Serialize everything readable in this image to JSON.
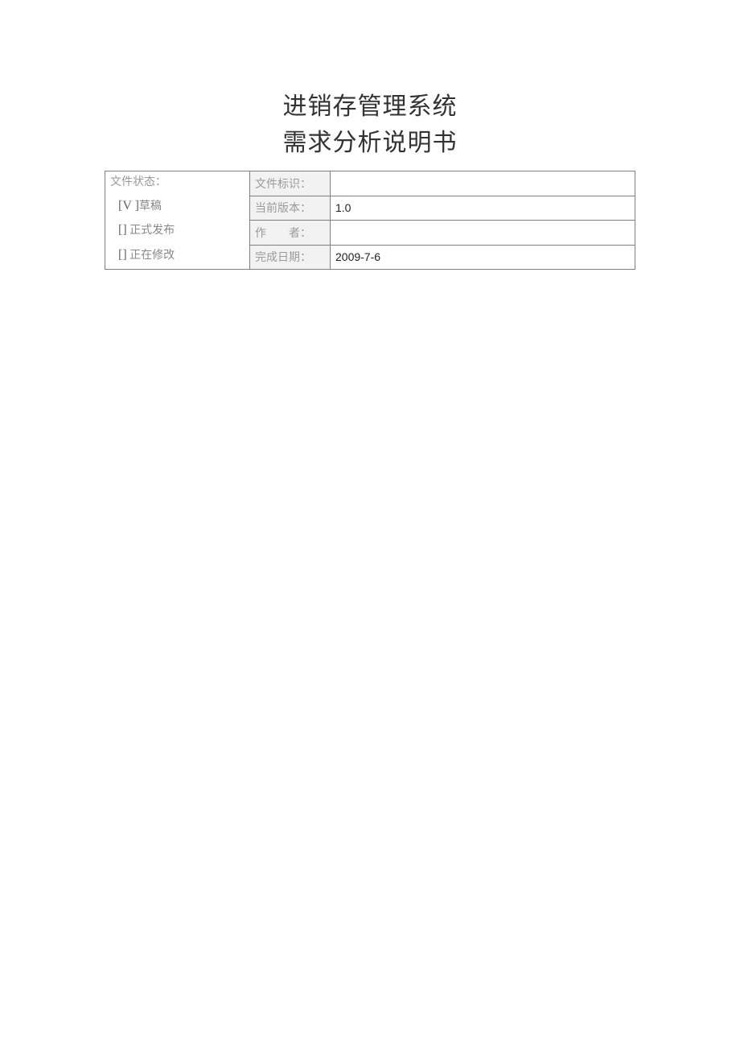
{
  "title": {
    "line1": "进销存管理系统",
    "line2": "需求分析说明书"
  },
  "status": {
    "header": "文件状态：",
    "options": [
      {
        "mark": "[V ]",
        "label": "草稿"
      },
      {
        "mark": "[]",
        "label": "正式发布"
      },
      {
        "mark": "[]",
        "label": "正在修改"
      }
    ]
  },
  "rows": [
    {
      "label": "文件标识：",
      "value": ""
    },
    {
      "label": "当前版本：",
      "value": "1.0"
    },
    {
      "label_prefix": "作",
      "label_suffix": "者：",
      "value": ""
    },
    {
      "label": "完成日期：",
      "value": "2009-7-6"
    }
  ]
}
